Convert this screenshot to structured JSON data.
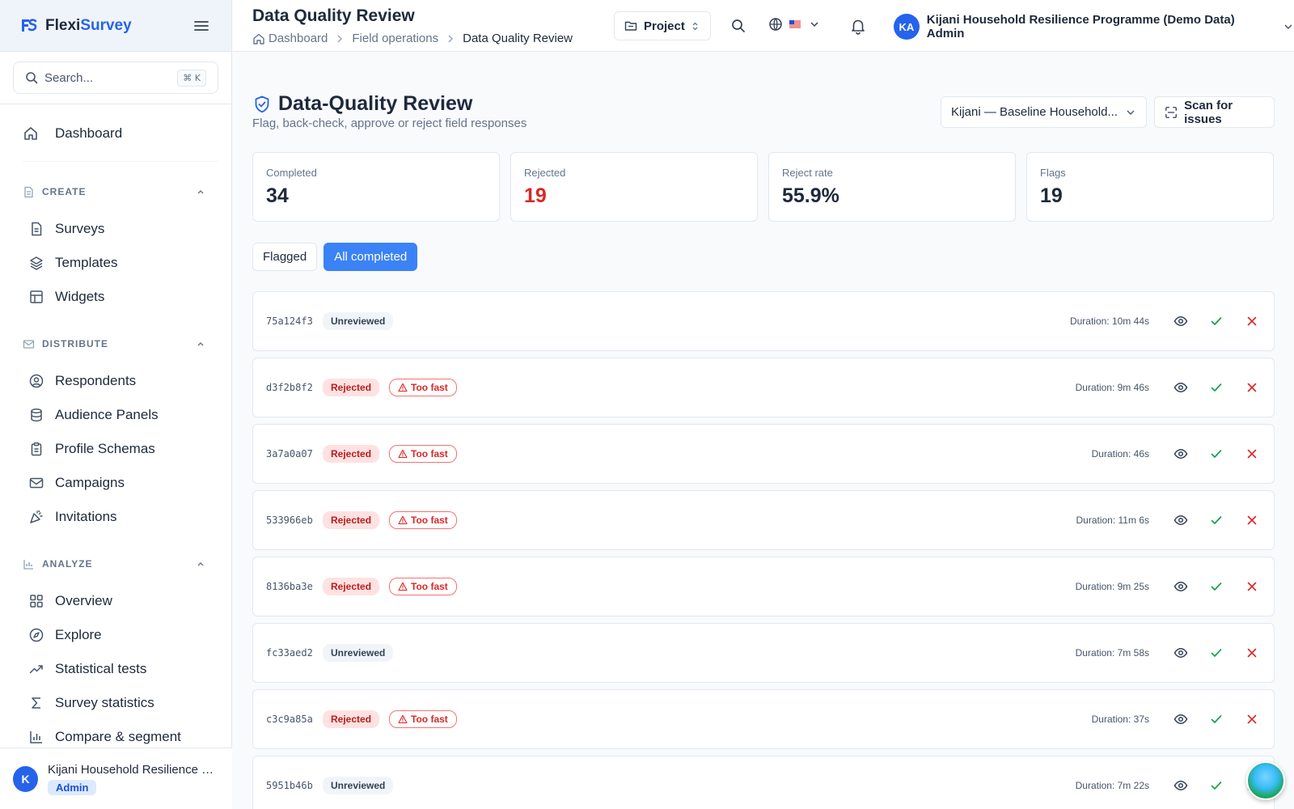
{
  "brand": {
    "name_a": "Flexi",
    "name_b": "Survey"
  },
  "sidebar": {
    "search_placeholder": "Search...",
    "search_shortcut": "⌘ K",
    "dashboard": "Dashboard",
    "sections": [
      {
        "title": "CREATE",
        "items": [
          "Surveys",
          "Templates",
          "Widgets"
        ]
      },
      {
        "title": "DISTRIBUTE",
        "items": [
          "Respondents",
          "Audience Panels",
          "Profile Schemas",
          "Campaigns",
          "Invitations"
        ]
      },
      {
        "title": "ANALYZE",
        "items": [
          "Overview",
          "Explore",
          "Statistical tests",
          "Survey statistics",
          "Compare & segment"
        ]
      }
    ],
    "footer": {
      "initial": "K",
      "name": "Kijani Household Resilience Programme (Demo Data) Admin",
      "role": "Admin"
    }
  },
  "topbar": {
    "title": "Data Quality Review",
    "breadcrumb": [
      "Dashboard",
      "Field operations",
      "Data Quality Review"
    ],
    "project_label": "Project",
    "user_initials": "KA",
    "user_name": "Kijani Household Resilience Programme (Demo Data) Admin"
  },
  "page": {
    "title": "Data-Quality Review",
    "subtitle": "Flag, back-check, approve or reject field responses",
    "survey_select": "Kijani — Baseline Household...",
    "scan_label": "Scan for issues"
  },
  "stats": [
    {
      "label": "Completed",
      "value": "34"
    },
    {
      "label": "Rejected",
      "value": "19"
    },
    {
      "label": "Reject rate",
      "value": "55.9%"
    },
    {
      "label": "Flags",
      "value": "19"
    }
  ],
  "tabs": {
    "flagged": "Flagged",
    "all": "All completed"
  },
  "colors": {
    "accent": "#3b82f6",
    "danger": "#dc2626",
    "success": "#16a34a"
  },
  "responses": [
    {
      "id": "75a124f3",
      "status": "Unreviewed",
      "flag": "",
      "duration": "Duration: 10m 44s"
    },
    {
      "id": "d3f2b8f2",
      "status": "Rejected",
      "flag": "Too fast",
      "duration": "Duration: 9m 46s"
    },
    {
      "id": "3a7a0a07",
      "status": "Rejected",
      "flag": "Too fast",
      "duration": "Duration: 46s"
    },
    {
      "id": "533966eb",
      "status": "Rejected",
      "flag": "Too fast",
      "duration": "Duration: 11m 6s"
    },
    {
      "id": "8136ba3e",
      "status": "Rejected",
      "flag": "Too fast",
      "duration": "Duration: 9m 25s"
    },
    {
      "id": "fc33aed2",
      "status": "Unreviewed",
      "flag": "",
      "duration": "Duration: 7m 58s"
    },
    {
      "id": "c3c9a85a",
      "status": "Rejected",
      "flag": "Too fast",
      "duration": "Duration: 37s"
    },
    {
      "id": "5951b46b",
      "status": "Unreviewed",
      "flag": "",
      "duration": "Duration: 7m 22s"
    }
  ]
}
